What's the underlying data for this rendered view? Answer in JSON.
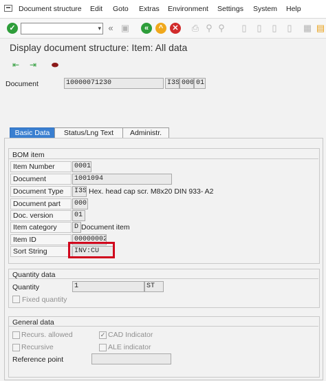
{
  "menu": {
    "items": [
      "Document structure",
      "Edit",
      "Goto",
      "Extras",
      "Environment",
      "Settings",
      "System",
      "Help"
    ]
  },
  "title": "Display document structure: Item: All data",
  "header": {
    "document_label": "Document",
    "document_number": "10000071230",
    "document_type": "I3S",
    "document_part": "000",
    "document_version": "01"
  },
  "tabs": [
    "Basic Data",
    "Status/Lng Text",
    "Administr."
  ],
  "bom_item": {
    "title": "BOM item",
    "item_number_label": "Item Number",
    "item_number": "0001",
    "document_label": "Document",
    "document": "1001094",
    "document_type_label": "Document Type",
    "document_type": "I3S",
    "document_type_desc": "Hex. head cap scr. M8x20  DIN 933- A2",
    "document_part_label": "Document part",
    "document_part": "000",
    "doc_version_label": "Doc. version",
    "doc_version": "01",
    "item_category_label": "Item category",
    "item_category": "D",
    "item_category_desc": "Document item",
    "item_id_label": "Item ID",
    "item_id": "00000002",
    "sort_string_label": "Sort String",
    "sort_string": "INV:CU"
  },
  "quantity_data": {
    "title": "Quantity data",
    "quantity_label": "Quantity",
    "quantity": "1",
    "unit": "ST",
    "fixed_quantity_label": "Fixed quantity"
  },
  "general_data": {
    "title": "General data",
    "recurs_allowed_label": "Recurs. allowed",
    "cad_indicator_label": "CAD Indicator",
    "recursive_label": "Recursive",
    "ale_indicator_label": "ALE indicator",
    "reference_point_label": "Reference point",
    "reference_point": ""
  },
  "colors": {
    "tab_active": "#3a7fd0",
    "highlight": "#d0021b",
    "ok": "#2e9d3a",
    "warn": "#f0a81c",
    "cancel": "#d12b2b"
  },
  "icons": [
    "enter-icon",
    "back-icon",
    "exit-icon",
    "cancel-icon",
    "save-icon",
    "print-icon",
    "find-icon",
    "first-page-icon",
    "previous-page-icon",
    "next-page-icon",
    "last-page-icon",
    "layout-icon",
    "help-icon",
    "previous-object-icon",
    "next-object-icon",
    "other-object-icon"
  ]
}
